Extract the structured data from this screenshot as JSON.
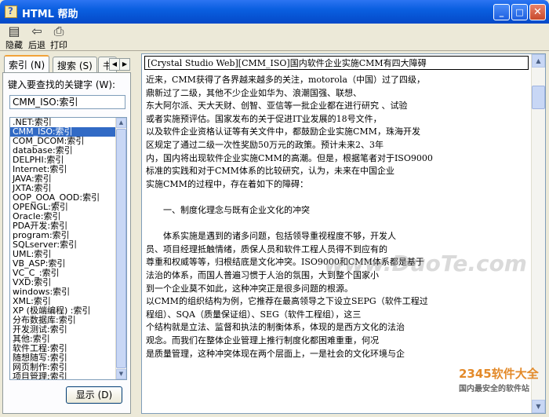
{
  "window": {
    "title": "HTML 帮助"
  },
  "titlebar": {
    "min": "_",
    "max": "□",
    "close": "✕"
  },
  "toolbar": {
    "items": [
      {
        "label": "隐藏",
        "icon": "hide-icon"
      },
      {
        "label": "后退",
        "icon": "back-icon"
      },
      {
        "label": "打印",
        "icon": "print-icon"
      }
    ]
  },
  "tabs": [
    {
      "label": "索引 (N)"
    },
    {
      "label": "搜索 (S)"
    },
    {
      "label": "书"
    }
  ],
  "index": {
    "keyword_label": "键入要查找的关键字 (W):",
    "keyword_value": "CMM_ISO:索引",
    "items": [
      ".NET:索引",
      "CMM_ISO:索引",
      "COM_DCOM:索引",
      "database:索引",
      "DELPHI:索引",
      "Internet:索引",
      "JAVA:索引",
      "JXTA:索引",
      "OOP_OOA_OOD:索引",
      "OPENGL:索引",
      "Oracle:索引",
      "PDA开发:索引",
      "program:索引",
      "SQLserver:索引",
      "UML:索引",
      "VB_ASP:索引",
      "VC_C_:索引",
      "VXD:索引",
      "windows:索引",
      "XML:索引",
      "XP (极端编程) :索引",
      "分布数据库:索引",
      "开发测试:索引",
      "其他:索引",
      "软件工程:索引",
      "随想随写:索引",
      "网页制作:索引",
      "项目管理:索引"
    ],
    "selected_index": 1,
    "display_button": "显示 (D)"
  },
  "document": {
    "title": "[Crystal Studio Web][CMM_ISO]国内软件企业实施CMM有四大障碍",
    "lines": [
      "近来，CMM获得了各界越来越多的关注，motorola（中国）过了四级，",
      "鼎新过了二级，其他不少企业如华为、浪潮国强、联想、",
      "东大阿尔派、天大天财、创智、亚信等一批企业都在进行研究 、试验",
      "或者实施预评估。国家发布的关于促进IT业发展的18号文件，",
      "以及软件企业资格认证等有关文件中，都鼓励企业实施CMM，珠海开发",
      "区规定了通过二级一次性奖励50万元的政策。预计未来2、3年",
      "内，国内将出现软件企业实施CMM的高潮。但是，根据笔者对于ISO9000",
      "标准的实践和对于CMM体系的比较研究，认为，未来在中国企业",
      "实施CMM的过程中，存在着如下的障碍："
    ],
    "heading": "一、制度化理念与既有企业文化的冲突",
    "lines2": [
      "体系实施是遇到的诸多问题，包括领导重视程度不够，开发人",
      "员、项目经理抵触情绪，质保人员和软件工程人员得不到应有的",
      "尊重和权威等等，归根结底是文化冲突。ISO9000和CMM体系都是基于",
      "法治的体系，而国人普遍习惯于人治的氛围，大到整个国家小",
      "到一个企业莫不如此，这种冲突正是很多问题的根源。",
      "以CMM的组织结构为例，它推荐在最高领导之下设立SEPG（软件工程过",
      "程组）、SQA（质量保证组）、SEG（软件工程组），这三",
      "个结构就是立法、监督和执法的制衡体系，体现的是西方文化的法治",
      "观念。而我们在整体企业管理上推行制度化都困难重重，何况",
      "是质量管理，这种冲突体现在两个层面上，一是社会的文化环境与企"
    ]
  },
  "watermark": {
    "center": "www.DuoTe.com",
    "logo": "2345软件大全",
    "logo_sub": "国内最安全的软件站"
  }
}
